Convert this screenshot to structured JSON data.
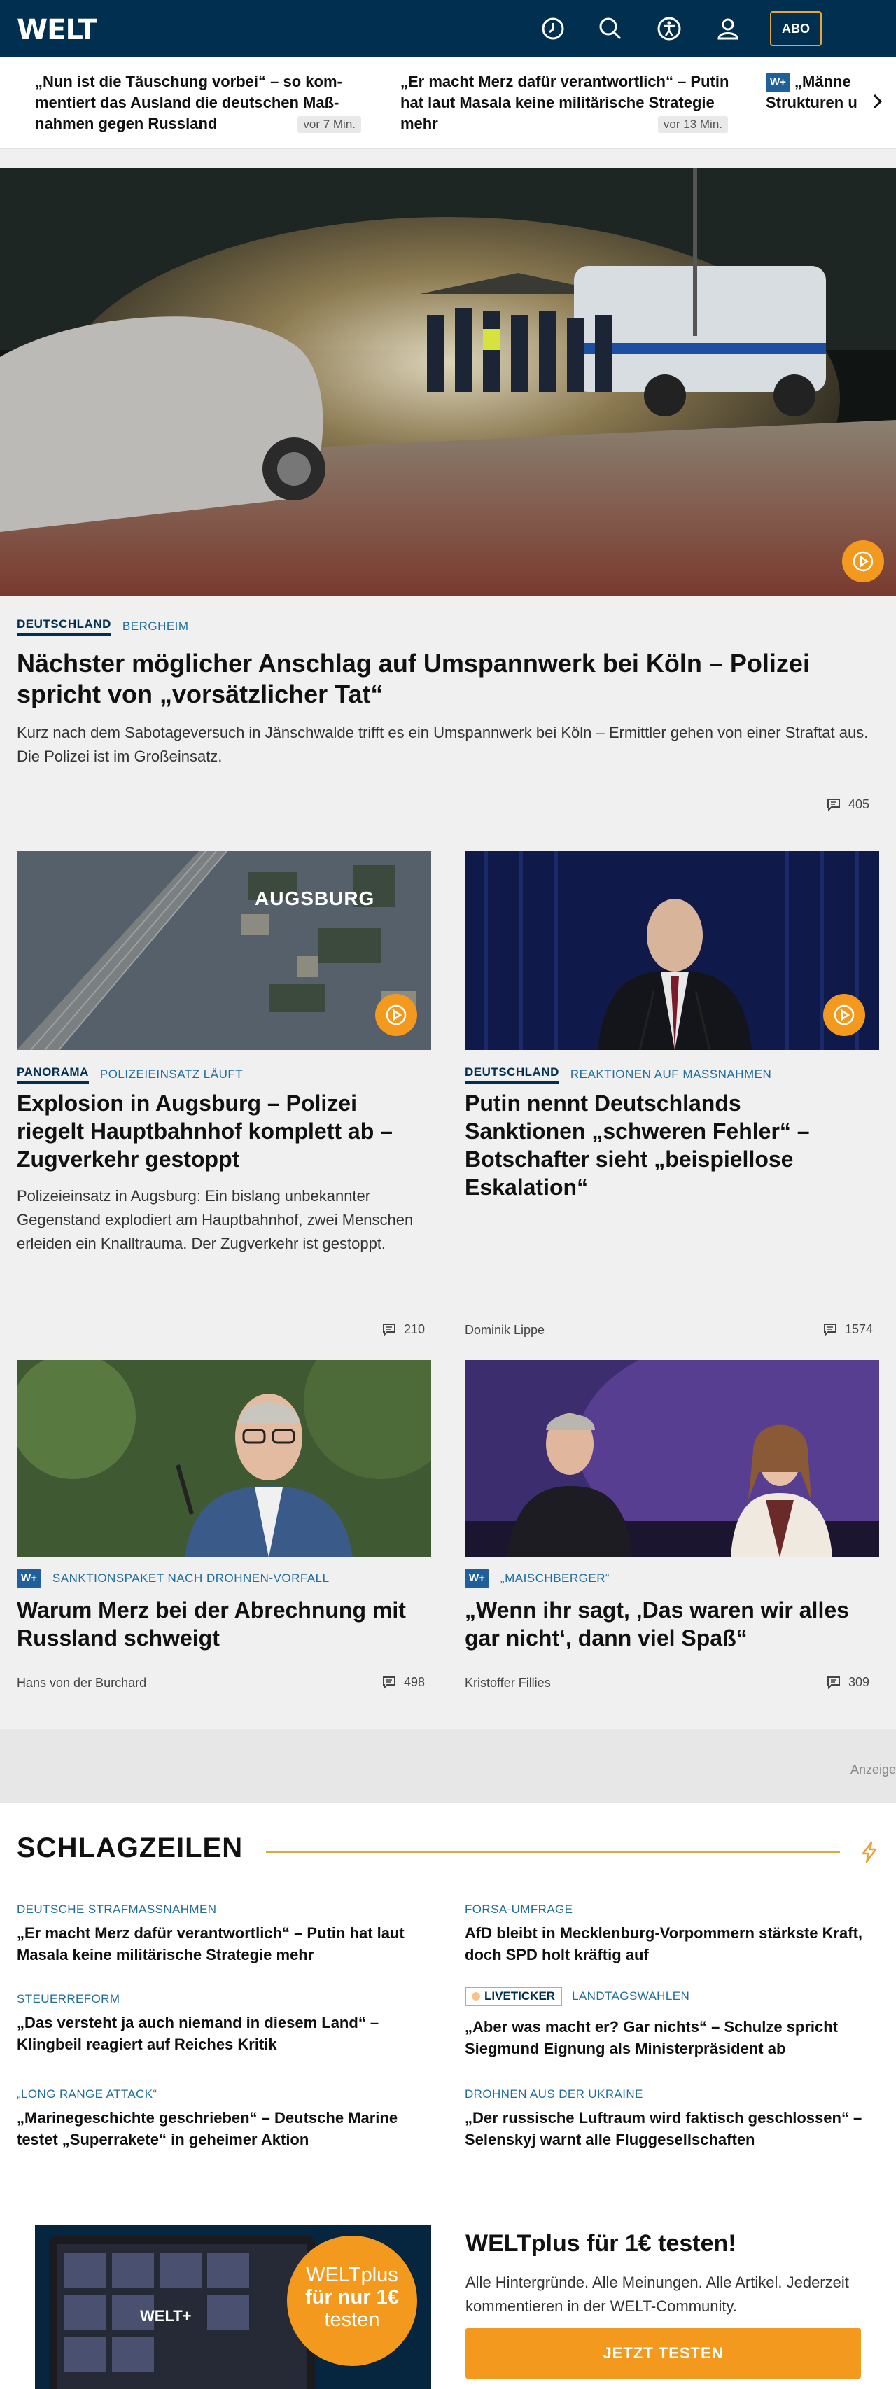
{
  "header": {
    "logo": "WELT",
    "abo_label": "ABO"
  },
  "ticker": [
    {
      "title": "„Nun ist die Täuschung vorbei“ – so kom­mentiert das Ausland die deutschen Maß­nahmen gegen Russland",
      "time": "vor 7 Min."
    },
    {
      "title": "„Er macht Merz dafür verantwortlich“ – Putin hat laut Masala keine militärische Strategie mehr",
      "time": "vor 13 Min."
    },
    {
      "badge": "W+",
      "title": "„Männe Strukturen u"
    }
  ],
  "hero": {
    "kicker": "DEUTSCHLAND",
    "subkicker": "BERGHEIM",
    "title": "Nächster möglicher Anschlag auf Umspannwerk bei Köln – Polizei spricht von „vorsätzlicher Tat“",
    "teaser": "Kurz nach dem Sabotageversuch in Jänschwalde trifft es ein Umspannwerk bei Köln – Ermittler gehen von einer Straftat aus. Die Polizei ist im Großeinsatz.",
    "comments": "405"
  },
  "cards": [
    {
      "kicker": "PANORAMA",
      "subkicker": "POLIZEIEINSATZ LÄUFT",
      "title": "Explosion in Augsburg – Polizei riegelt Hauptbahnhof komplett ab – Zugverkehr gestoppt",
      "teaser": "Polizeieinsatz in Augsburg: Ein bislang unbekannter Gegenstand explodiert am Hauptbahnhof, zwei Menschen erleiden ein Knalltrauma. Der Zugverkehr ist gestoppt.",
      "comments": "210",
      "img_label": "AUGSBURG"
    },
    {
      "kicker": "DEUTSCHLAND",
      "subkicker": "REAKTIONEN AUF MASSNAHMEN",
      "title": "Putin nennt Deutschlands Sanktionen „schweren Fehler“ – Botschafter sieht „beispiellose Eskalation“",
      "author": "Dominik Lippe",
      "comments": "1574"
    },
    {
      "badge": "W+",
      "subkicker": "SANKTIONSPAKET NACH DROHNEN-VORFALL",
      "title": "Warum Merz bei der Abrechnung mit Russland schweigt",
      "author": "Hans von der Burchard",
      "comments": "498"
    },
    {
      "badge": "W+",
      "subkicker": "„MAISCHBERGER“",
      "title": "„Wenn ihr sagt, ‚Das waren wir alles gar nicht‘, dann viel Spaß“",
      "author": "Kristoffer Fillies",
      "comments": "309"
    }
  ],
  "ad_label": "Anzeige",
  "schlagzeilen": {
    "title": "SCHLAGZEILEN",
    "items": [
      {
        "kicker": "DEUTSCHE STRAFMASSNAHMEN",
        "title": "„Er macht Merz dafür verantwortlich“ – Putin hat laut Masala keine militärische Strategie mehr"
      },
      {
        "kicker": "FORSA-UMFRAGE",
        "title": "AfD bleibt in Mecklenburg-Vorpommern stärkste Kraft, doch SPD holt kräftig auf"
      },
      {
        "kicker": "STEUERREFORM",
        "title": "„Das versteht ja auch niemand in diesem Land“ – Klingbeil reagiert auf Reiches Kritik"
      },
      {
        "live": "LIVETICKER",
        "kicker": "LANDTAGSWAHLEN",
        "title": "„Aber was macht er? Gar nichts“ – Schulze spricht Siegmund Eignung als Ministerpräsident ab"
      },
      {
        "kicker": "„LONG RANGE ATTACK“",
        "title": "„Marinegeschichte geschrieben“ – Deutsche Marine testet „Superrakete“ in geheimer Aktion"
      },
      {
        "kicker": "DROHNEN AUS DER UKRAINE",
        "title": "„Der russische Luftraum wird faktisch geschlossen“ – Selenskyj warnt alle Fluggesellschaften"
      }
    ]
  },
  "promo": {
    "badge_line1": "WELTplus",
    "badge_line2": "für nur 1€",
    "badge_line3": "testen",
    "title": "WELTplus für 1€ testen!",
    "text": "Alle Hintergründe. Alle Meinungen. Alle Artikel. Jederzeit kommentieren in der WELT-Community.",
    "button": "JETZT TESTEN"
  },
  "colors": {
    "brand": "#002f4f",
    "accent": "#f39a1e",
    "link": "#1f6d9c"
  }
}
